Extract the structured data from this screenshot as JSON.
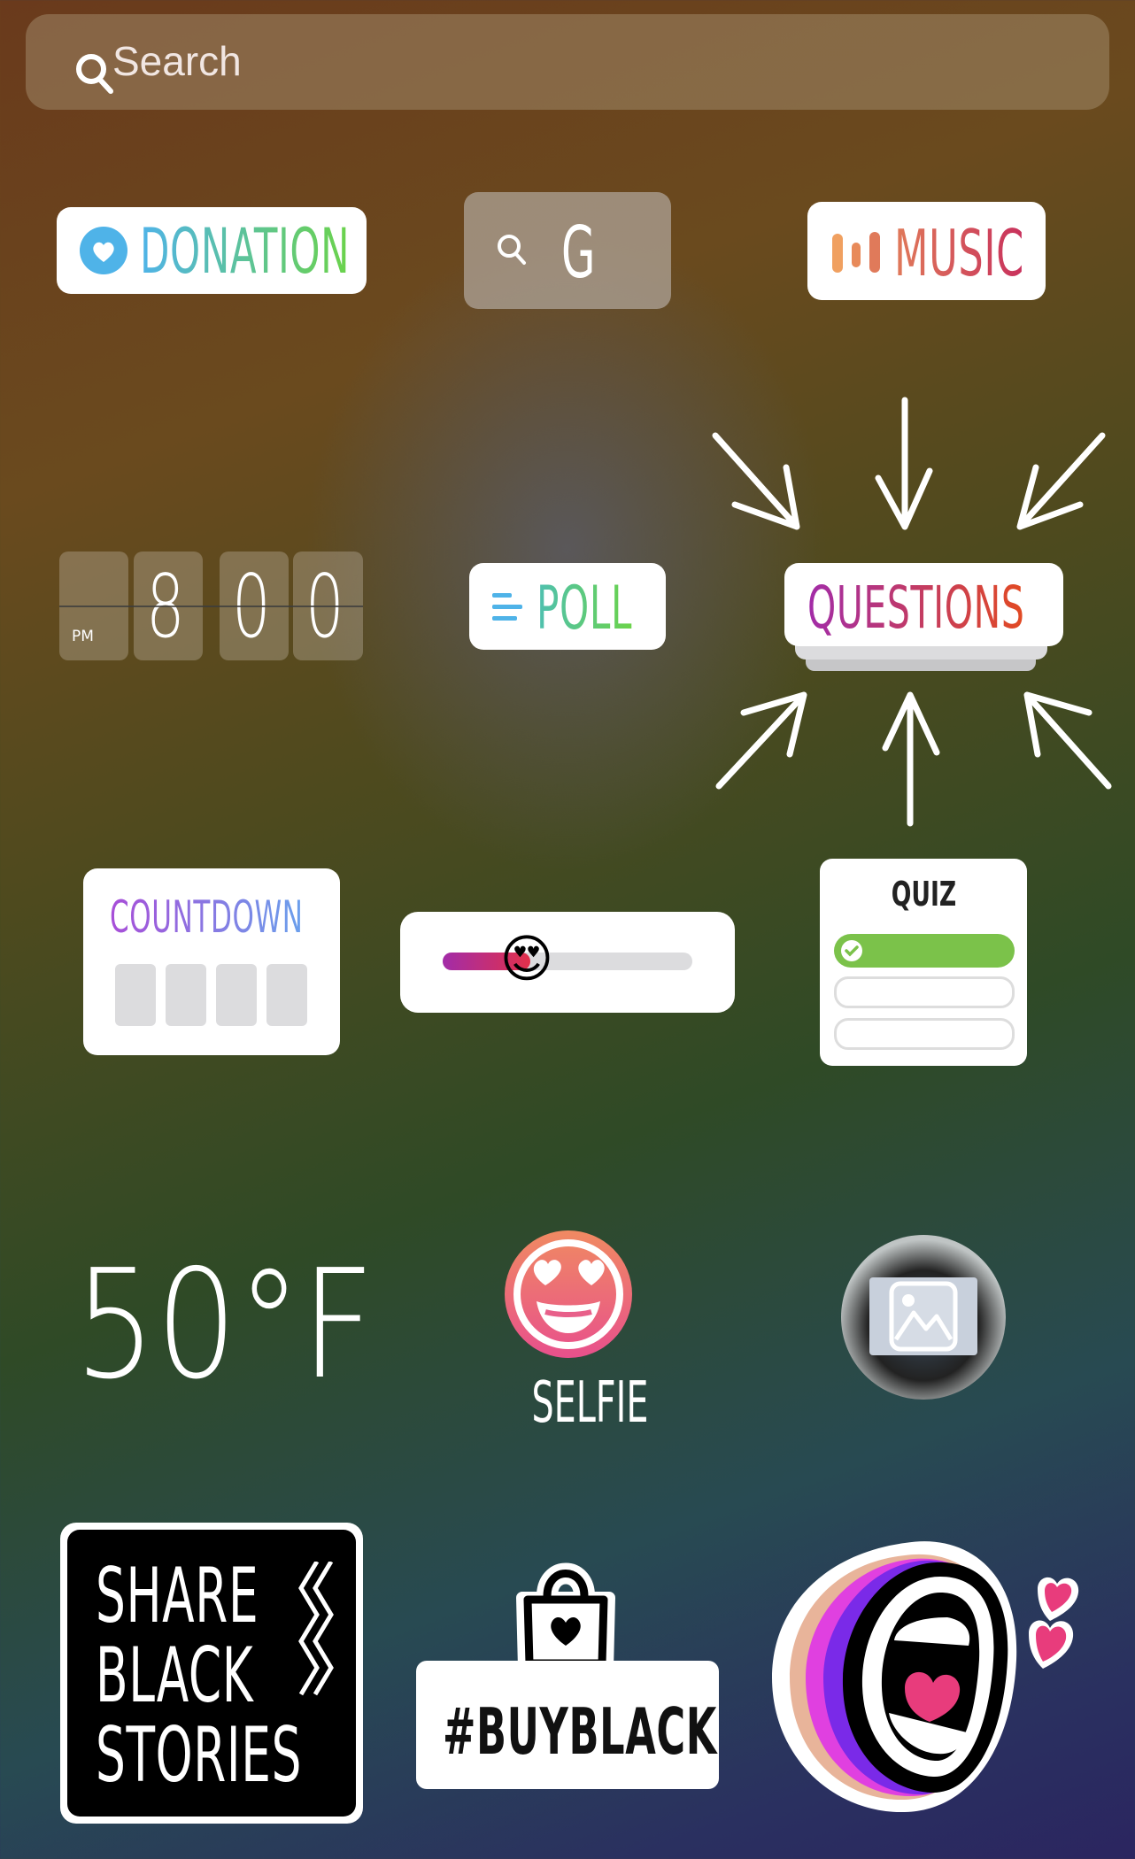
{
  "search": {
    "placeholder": "Search",
    "icon": "search-icon"
  },
  "stickers": {
    "donation": {
      "label": "DONATION",
      "icon": "heart-circle-icon"
    },
    "gif": {
      "label": "G",
      "icon": "search-icon"
    },
    "music": {
      "label": "MUSIC",
      "icon": "audio-bars-icon"
    },
    "clock": {
      "meridiem": "PM",
      "hour": "8",
      "minute_tens": "0",
      "minute_ones": "0"
    },
    "poll": {
      "label": "POLL",
      "icon": "lines-icon"
    },
    "questions": {
      "label": "QUESTIONS"
    },
    "countdown": {
      "label": "COUNTDOWN"
    },
    "slider": {
      "emoji": "😍",
      "value": 0.35
    },
    "quiz": {
      "label": "QUIZ",
      "icon": "check-icon"
    },
    "weather": {
      "label": "50°F"
    },
    "selfie": {
      "label": "SELFIE",
      "emoji": "😍"
    },
    "photo": {
      "icon": "image-icon"
    },
    "share_black_stories": {
      "lines": [
        "SHARE",
        "BLACK",
        "STORIES"
      ]
    },
    "buy_black": {
      "label": "#BUYBLACK",
      "icon": "shopping-bag-heart-icon"
    },
    "mouth": {
      "icon": "shouting-mouth-icon"
    }
  },
  "colors": {
    "donation_gradient": [
      "#4fb3e8",
      "#6bd34a"
    ],
    "music_gradient": [
      "#f0a060",
      "#c8305c"
    ],
    "poll_gradient": [
      "#4fb3e8",
      "#6bd34a"
    ],
    "questions_gradient": [
      "#a22ca8",
      "#e24a22"
    ],
    "countdown_gradient": [
      "#a84ed8",
      "#6aa0ec"
    ],
    "quiz_green": "#7bc24a",
    "heart_pink": "#e83c7c"
  }
}
